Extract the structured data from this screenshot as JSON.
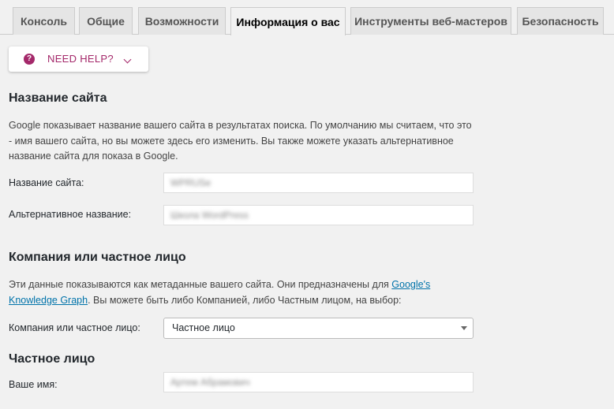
{
  "tabs": [
    {
      "label": "Консоль",
      "active": false
    },
    {
      "label": "Общие",
      "active": false
    },
    {
      "label": "Возможности",
      "active": false
    },
    {
      "label": "Информация о вас",
      "active": true
    },
    {
      "label": "Инструменты веб-мастеров",
      "active": false
    },
    {
      "label": "Безопасность",
      "active": false
    }
  ],
  "help": {
    "icon": "question-circle-icon",
    "label": "NEED HELP?"
  },
  "site_name_section": {
    "title": "Название сайта",
    "description": "Google показывает название вашего сайта в результатах поиска. По умолчанию мы считаем, что это - имя вашего сайта, но вы можете здесь его изменить. Вы также можете указать альтернативное название сайта для показа в Google.",
    "site_name_label": "Название сайта:",
    "site_name_value": "WPRUSe",
    "alt_name_label": "Альтернативное название:",
    "alt_name_value": "Школа WordPress"
  },
  "company_section": {
    "title": "Компания или частное лицо",
    "description_before": "Эти данные показываются как метаданные вашего сайта. Они предназначены для ",
    "link_text": "Google's Knowledge Graph",
    "description_after": ". Вы можете быть либо Компанией, либо Частным лицом, на выбор:",
    "select_label": "Компания или частное лицо:",
    "select_value": "Частное лицо"
  },
  "person_section": {
    "title": "Частное лицо",
    "name_label": "Ваше имя:",
    "name_value": "Артем Абрамович"
  }
}
